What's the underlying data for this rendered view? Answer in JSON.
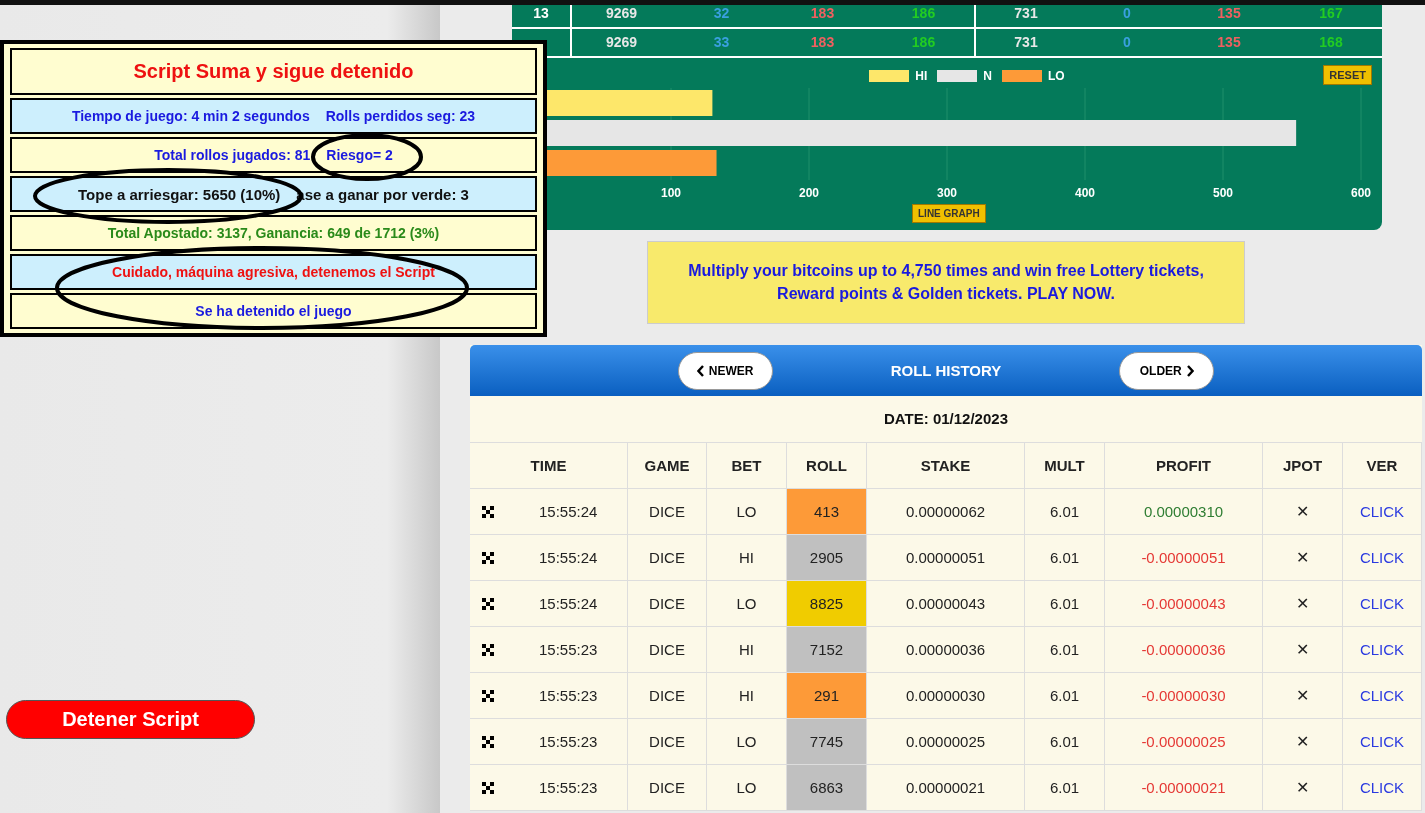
{
  "script_panel": {
    "lines": [
      {
        "kind": "title",
        "texts": [
          "Script Suma y sigue detenido"
        ]
      },
      {
        "kind": "info",
        "texts": [
          "Tiempo de juego: 4 min 2 segundos",
          "Rolls perdidos seg: 23"
        ]
      },
      {
        "kind": "info",
        "texts": [
          "Total rollos jugados: 81",
          "Riesgo= 2"
        ]
      },
      {
        "kind": "emphasis",
        "texts": [
          "Tope a arriesgar: 5650  (10%)",
          "ase a ganar por verde: 3"
        ]
      },
      {
        "kind": "total",
        "texts": [
          "Total Apostado: 3137, Ganancia: 649 de 1712 (3%)"
        ]
      },
      {
        "kind": "warning",
        "texts": [
          "Cuidado, máquina agresiva, detenemos el Script"
        ]
      },
      {
        "kind": "info",
        "texts": [
          "Se ha detenido el juego"
        ]
      }
    ]
  },
  "stop_button": "Detener Script",
  "stats_table": {
    "rows": [
      {
        "cells": [
          "13",
          "9269",
          "32",
          "183",
          "186",
          "731",
          "0",
          "135",
          "167"
        ]
      },
      {
        "cells": [
          "",
          "9269",
          "33",
          "183",
          "186",
          "731",
          "0",
          "135",
          "168"
        ]
      }
    ]
  },
  "roll_chart": {
    "reset_button": "RESET",
    "line_graph_button": "LINE GRAPH",
    "chart_data": {
      "type": "bar",
      "orientation": "horizontal",
      "grid": true,
      "xlim": [
        0,
        600
      ],
      "xticks": [
        100,
        200,
        300,
        400,
        500,
        600
      ],
      "series": [
        {
          "name": "HI",
          "color": "#fde76a",
          "values": [
            130
          ]
        },
        {
          "name": "N",
          "color": "#e6e6e6",
          "values": [
            553
          ]
        },
        {
          "name": "LO",
          "color": "#fd9a38",
          "values": [
            133
          ]
        }
      ]
    }
  },
  "banner": {
    "lines": [
      "Multiply your bitcoins up to 4,750 times and win free Lottery tickets,",
      "Reward points & Golden tickets. PLAY NOW."
    ]
  },
  "roll_history": {
    "title": "ROLL HISTORY",
    "newer_button": "NEWER",
    "older_button": "OLDER",
    "date": "DATE: 01/12/2023",
    "columns": [
      "TIME",
      "GAME",
      "BET",
      "ROLL",
      "STAKE",
      "MULT",
      "PROFIT",
      "JPOT",
      "VER"
    ],
    "rows": [
      {
        "time": "15:55:24",
        "game": "DICE",
        "bet": "LO",
        "roll": {
          "value": "413",
          "color": "#fd9a38"
        },
        "stake": "0.00000062",
        "mult": "6.01",
        "profit": {
          "value": "0.00000310",
          "color": "#2e7d32"
        },
        "jpot": "✕",
        "ver": "CLICK"
      },
      {
        "time": "15:55:24",
        "game": "DICE",
        "bet": "HI",
        "roll": {
          "value": "2905",
          "color": "#c0c0c0"
        },
        "stake": "0.00000051",
        "mult": "6.01",
        "profit": {
          "value": "-0.00000051",
          "color": "#e53935"
        },
        "jpot": "✕",
        "ver": "CLICK"
      },
      {
        "time": "15:55:24",
        "game": "DICE",
        "bet": "LO",
        "roll": {
          "value": "8825",
          "color": "#f0cc00"
        },
        "stake": "0.00000043",
        "mult": "6.01",
        "profit": {
          "value": "-0.00000043",
          "color": "#e53935"
        },
        "jpot": "✕",
        "ver": "CLICK"
      },
      {
        "time": "15:55:23",
        "game": "DICE",
        "bet": "HI",
        "roll": {
          "value": "7152",
          "color": "#c0c0c0"
        },
        "stake": "0.00000036",
        "mult": "6.01",
        "profit": {
          "value": "-0.00000036",
          "color": "#e53935"
        },
        "jpot": "✕",
        "ver": "CLICK"
      },
      {
        "time": "15:55:23",
        "game": "DICE",
        "bet": "HI",
        "roll": {
          "value": "291",
          "color": "#fd9a38"
        },
        "stake": "0.00000030",
        "mult": "6.01",
        "profit": {
          "value": "-0.00000030",
          "color": "#e53935"
        },
        "jpot": "✕",
        "ver": "CLICK"
      },
      {
        "time": "15:55:23",
        "game": "DICE",
        "bet": "LO",
        "roll": {
          "value": "7745",
          "color": "#c0c0c0"
        },
        "stake": "0.00000025",
        "mult": "6.01",
        "profit": {
          "value": "-0.00000025",
          "color": "#e53935"
        },
        "jpot": "✕",
        "ver": "CLICK"
      },
      {
        "time": "15:55:23",
        "game": "DICE",
        "bet": "LO",
        "roll": {
          "value": "6863",
          "color": "#c0c0c0"
        },
        "stake": "0.00000021",
        "mult": "6.01",
        "profit": {
          "value": "-0.00000021",
          "color": "#e53935"
        },
        "jpot": "✕",
        "ver": "CLICK"
      }
    ]
  }
}
